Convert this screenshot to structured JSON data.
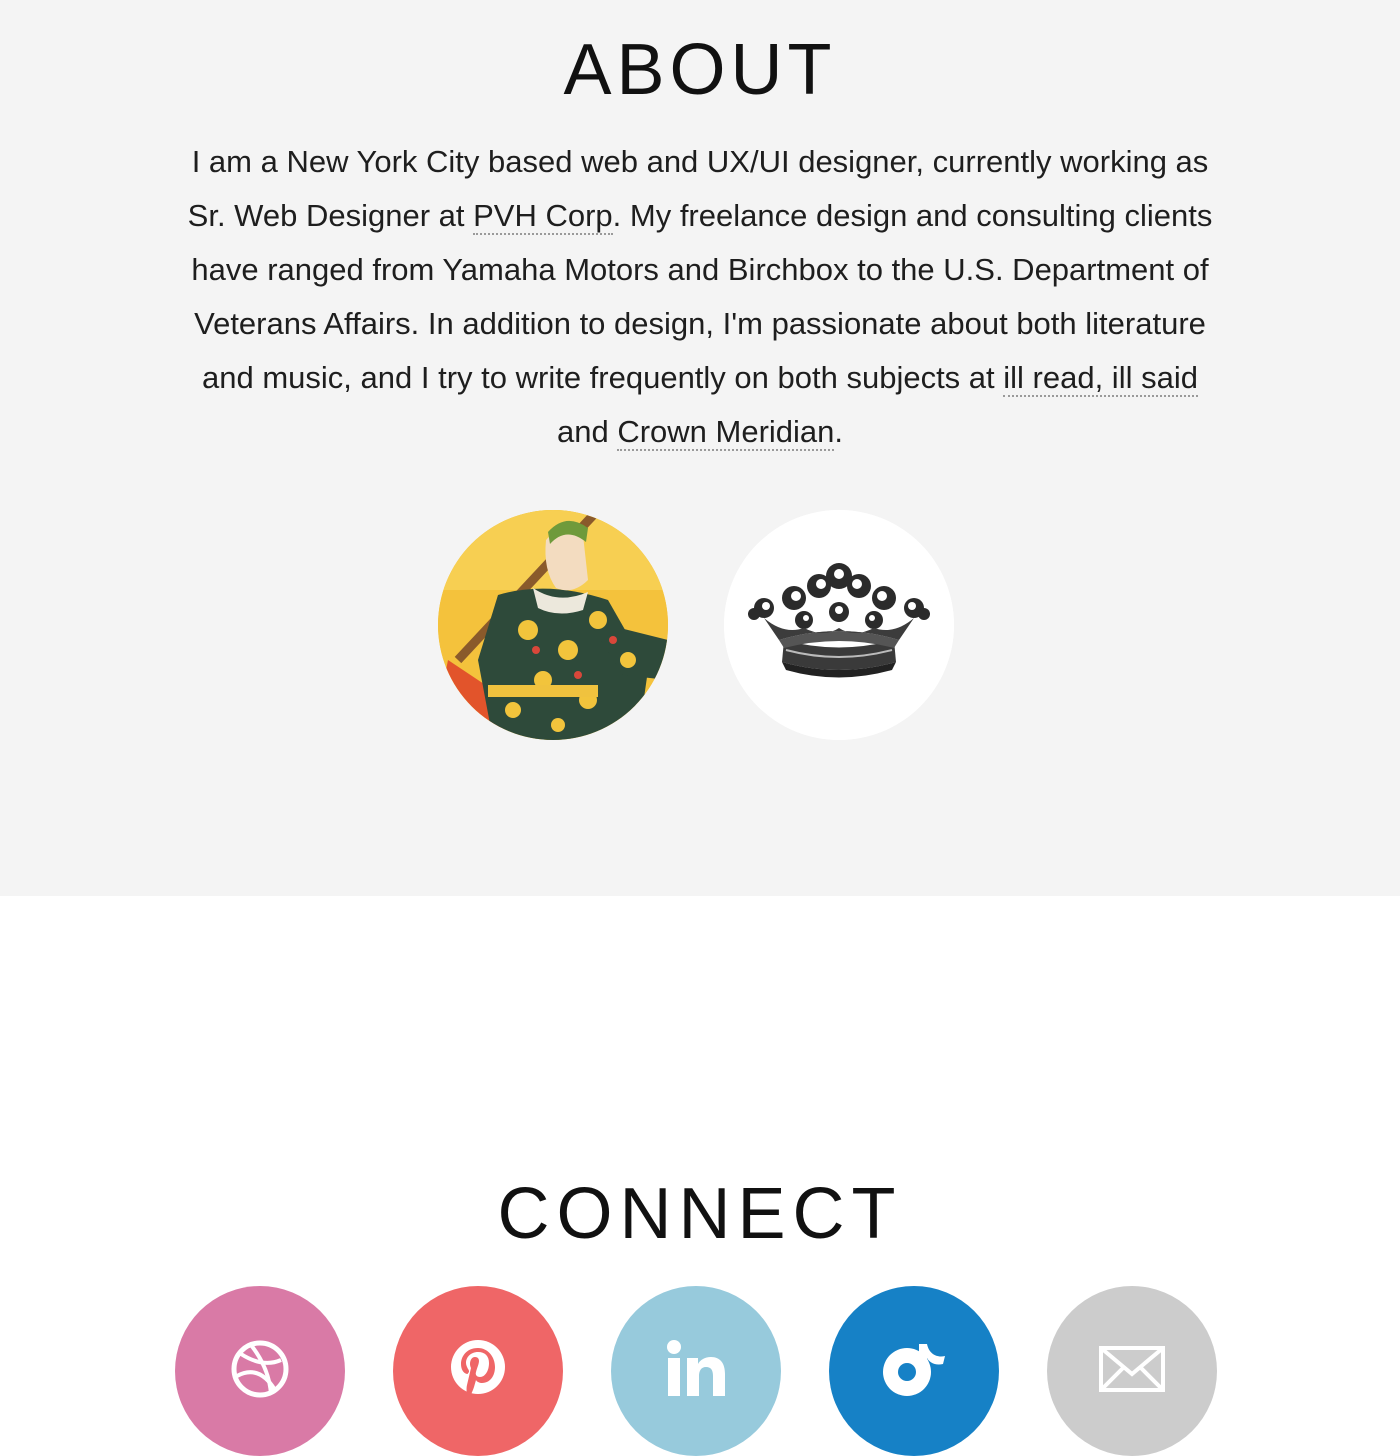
{
  "about": {
    "title": "ABOUT",
    "bio": {
      "t1": "I am a New York City based web and UX/UI designer, currently working as Sr. Web Designer at ",
      "link_employer": "PVH Corp",
      "t2": ". My freelance design and consulting clients have ranged from Yamaha Motors and Birchbox to the U.S. Department of Veterans Affairs. In addition to design, I'm passionate about both literature and music, and I try to write frequently on both subjects at ",
      "link_blog1": "ill read, ill said",
      "t3": " and ",
      "link_blog2": "Crown Meridian",
      "t4": "."
    },
    "blog_images": [
      {
        "name": "ill read, ill said",
        "icon": "tarot-figure-image"
      },
      {
        "name": "Crown Meridian",
        "icon": "crown-image"
      }
    ]
  },
  "connect": {
    "title": "CONNECT",
    "links": [
      {
        "icon": "dribbble-icon",
        "color": "#d97aa6"
      },
      {
        "icon": "pinterest-icon",
        "color": "#ef6667"
      },
      {
        "icon": "linkedin-icon",
        "color": "#97cadc"
      },
      {
        "icon": "rdio-icon",
        "color": "#1681c6"
      },
      {
        "icon": "email-icon",
        "color": "#cccccc"
      }
    ]
  }
}
